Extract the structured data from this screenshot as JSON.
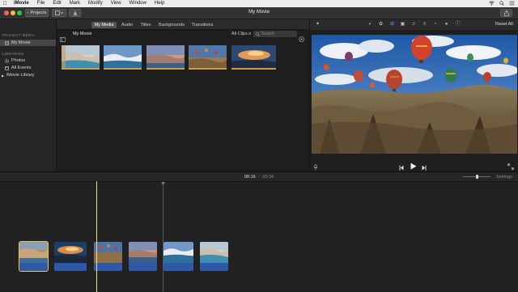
{
  "menubar": {
    "apple": "",
    "items": [
      "iMovie",
      "File",
      "Edit",
      "Mark",
      "Modify",
      "View",
      "Window",
      "Help"
    ]
  },
  "toolbar": {
    "projects_label": "Projects",
    "window_title": "My Movie"
  },
  "sidebar": {
    "project_media_header": "PROJECT MEDIA",
    "project_item": "My Movie",
    "libraries_header": "LIBRARIES",
    "library_items": [
      "Photos",
      "All Events",
      "iMovie Library"
    ]
  },
  "browser": {
    "tabs": [
      "My Media",
      "Audio",
      "Titles",
      "Backgrounds",
      "Transitions"
    ],
    "selected_tab": "My Media",
    "header_title": "My Movie",
    "filter_label": "All Clips",
    "search_placeholder": "Search"
  },
  "viewer": {
    "reset_all_label": "Reset All"
  },
  "timeline": {
    "current_time": "00:16",
    "separator": "/",
    "total_time": "00:34",
    "settings_label": "Settings"
  },
  "colors": {
    "accent_gold": "#c8a04a",
    "audio_blue": "#2f58a8",
    "selection": "#474747"
  }
}
